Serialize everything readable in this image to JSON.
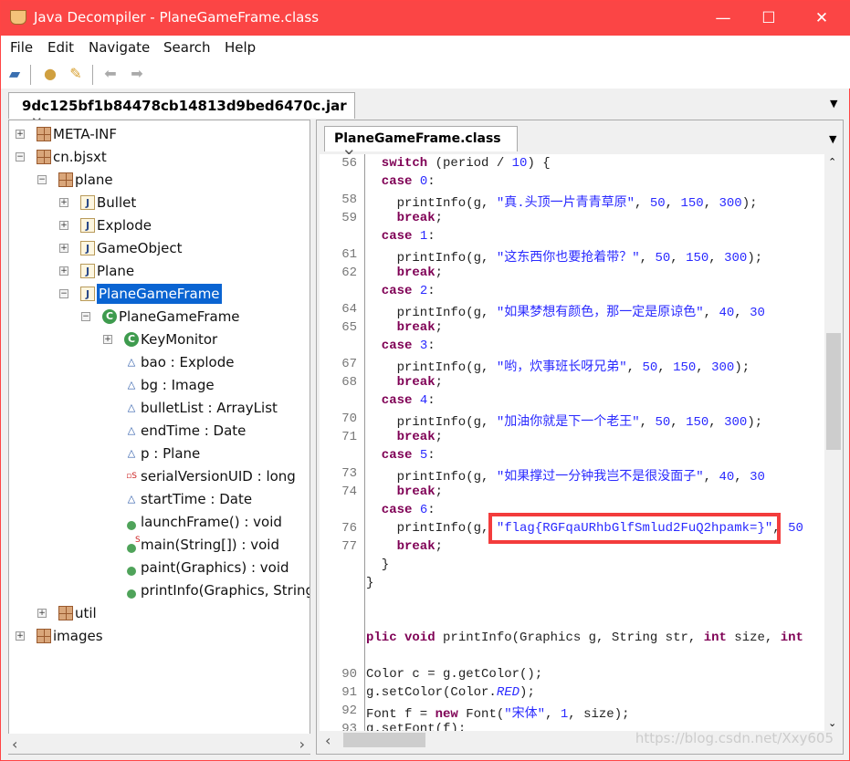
{
  "window": {
    "title": "Java Decompiler - PlaneGameFrame.class",
    "minimize": "—",
    "maximize": "☐",
    "close": "✕"
  },
  "menu": [
    "File",
    "Edit",
    "Navigate",
    "Search",
    "Help"
  ],
  "toolbar": {
    "icons": [
      "open-file-icon",
      "open-type-icon",
      "search-icon",
      "back-icon",
      "forward-icon"
    ],
    "back": "⬅",
    "forward": "➡"
  },
  "outer_tab": {
    "label": "9dc125bf1b84478cb14813d9bed6470c.jar",
    "close": "✕"
  },
  "tree": [
    {
      "depth": 0,
      "exp": "+",
      "icon": "package",
      "label": "META-INF"
    },
    {
      "depth": 0,
      "exp": "−",
      "icon": "package",
      "label": "cn.bjsxt"
    },
    {
      "depth": 1,
      "exp": "−",
      "icon": "package",
      "label": "plane"
    },
    {
      "depth": 2,
      "exp": "+",
      "icon": "java",
      "label": "Bullet"
    },
    {
      "depth": 2,
      "exp": "+",
      "icon": "java",
      "label": "Explode"
    },
    {
      "depth": 2,
      "exp": "+",
      "icon": "java",
      "label": "GameObject"
    },
    {
      "depth": 2,
      "exp": "+",
      "icon": "java",
      "label": "Plane"
    },
    {
      "depth": 2,
      "exp": "−",
      "icon": "java",
      "label": "PlaneGameFrame",
      "selected": true
    },
    {
      "depth": 3,
      "exp": "−",
      "icon": "class",
      "label": "PlaneGameFrame"
    },
    {
      "depth": 4,
      "exp": "+",
      "icon": "class",
      "label": "KeyMonitor"
    },
    {
      "depth": 4,
      "icon": "field",
      "label": "bao : Explode"
    },
    {
      "depth": 4,
      "icon": "field",
      "label": "bg : Image"
    },
    {
      "depth": 4,
      "icon": "field",
      "label": "bulletList : ArrayList"
    },
    {
      "depth": 4,
      "icon": "field",
      "label": "endTime : Date"
    },
    {
      "depth": 4,
      "icon": "field",
      "label": "p : Plane"
    },
    {
      "depth": 4,
      "icon": "static-field",
      "label": "serialVersionUID : long"
    },
    {
      "depth": 4,
      "icon": "field",
      "label": "startTime : Date"
    },
    {
      "depth": 4,
      "icon": "method",
      "label": "launchFrame() : void"
    },
    {
      "depth": 4,
      "icon": "static-method",
      "label": "main(String[]) : void"
    },
    {
      "depth": 4,
      "icon": "method",
      "label": "paint(Graphics) : void"
    },
    {
      "depth": 4,
      "icon": "method",
      "label": "printInfo(Graphics, String"
    },
    {
      "depth": 1,
      "exp": "+",
      "icon": "package",
      "label": "util"
    },
    {
      "depth": 0,
      "exp": "+",
      "icon": "package",
      "label": "images"
    }
  ],
  "code_tab": {
    "label": "PlaneGameFrame.class",
    "close": "✕"
  },
  "code": [
    {
      "n": "56",
      "i": 2,
      "t": [
        [
          "kw",
          "switch"
        ],
        [
          "p",
          " (period / "
        ],
        [
          "num",
          "10"
        ],
        [
          "p",
          ") {"
        ]
      ]
    },
    {
      "n": "",
      "i": 2,
      "t": [
        [
          "kw",
          "case"
        ],
        [
          "p",
          " "
        ],
        [
          "num",
          "0"
        ],
        [
          "p",
          ":"
        ]
      ]
    },
    {
      "n": "58",
      "i": 4,
      "t": [
        [
          "p",
          "printInfo(g, "
        ],
        [
          "str",
          "\"真.头顶一片青青草原\""
        ],
        [
          "p",
          ", "
        ],
        [
          "num",
          "50"
        ],
        [
          "p",
          ", "
        ],
        [
          "num",
          "150"
        ],
        [
          "p",
          ", "
        ],
        [
          "num",
          "300"
        ],
        [
          "p",
          ");"
        ]
      ]
    },
    {
      "n": "59",
      "i": 4,
      "t": [
        [
          "kw",
          "break"
        ],
        [
          "p",
          ";"
        ]
      ]
    },
    {
      "n": "",
      "i": 2,
      "t": [
        [
          "kw",
          "case"
        ],
        [
          "p",
          " "
        ],
        [
          "num",
          "1"
        ],
        [
          "p",
          ":"
        ]
      ]
    },
    {
      "n": "61",
      "i": 4,
      "t": [
        [
          "p",
          "printInfo(g, "
        ],
        [
          "str",
          "\"这东西你也要抢着带？\""
        ],
        [
          "p",
          ", "
        ],
        [
          "num",
          "50"
        ],
        [
          "p",
          ", "
        ],
        [
          "num",
          "150"
        ],
        [
          "p",
          ", "
        ],
        [
          "num",
          "300"
        ],
        [
          "p",
          ");"
        ]
      ]
    },
    {
      "n": "62",
      "i": 4,
      "t": [
        [
          "kw",
          "break"
        ],
        [
          "p",
          ";"
        ]
      ]
    },
    {
      "n": "",
      "i": 2,
      "t": [
        [
          "kw",
          "case"
        ],
        [
          "p",
          " "
        ],
        [
          "num",
          "2"
        ],
        [
          "p",
          ":"
        ]
      ]
    },
    {
      "n": "64",
      "i": 4,
      "t": [
        [
          "p",
          "printInfo(g, "
        ],
        [
          "str",
          "\"如果梦想有颜色，那一定是原谅色\""
        ],
        [
          "p",
          ", "
        ],
        [
          "num",
          "40"
        ],
        [
          "p",
          ", "
        ],
        [
          "num",
          "30"
        ]
      ]
    },
    {
      "n": "65",
      "i": 4,
      "t": [
        [
          "kw",
          "break"
        ],
        [
          "p",
          ";"
        ]
      ]
    },
    {
      "n": "",
      "i": 2,
      "t": [
        [
          "kw",
          "case"
        ],
        [
          "p",
          " "
        ],
        [
          "num",
          "3"
        ],
        [
          "p",
          ":"
        ]
      ]
    },
    {
      "n": "67",
      "i": 4,
      "t": [
        [
          "p",
          "printInfo(g, "
        ],
        [
          "str",
          "\"哟，炊事班长呀兄弟\""
        ],
        [
          "p",
          ", "
        ],
        [
          "num",
          "50"
        ],
        [
          "p",
          ", "
        ],
        [
          "num",
          "150"
        ],
        [
          "p",
          ", "
        ],
        [
          "num",
          "300"
        ],
        [
          "p",
          ");"
        ]
      ]
    },
    {
      "n": "68",
      "i": 4,
      "t": [
        [
          "kw",
          "break"
        ],
        [
          "p",
          ";"
        ]
      ]
    },
    {
      "n": "",
      "i": 2,
      "t": [
        [
          "kw",
          "case"
        ],
        [
          "p",
          " "
        ],
        [
          "num",
          "4"
        ],
        [
          "p",
          ":"
        ]
      ]
    },
    {
      "n": "70",
      "i": 4,
      "t": [
        [
          "p",
          "printInfo(g, "
        ],
        [
          "str",
          "\"加油你就是下一个老王\""
        ],
        [
          "p",
          ", "
        ],
        [
          "num",
          "50"
        ],
        [
          "p",
          ", "
        ],
        [
          "num",
          "150"
        ],
        [
          "p",
          ", "
        ],
        [
          "num",
          "300"
        ],
        [
          "p",
          ");"
        ]
      ]
    },
    {
      "n": "71",
      "i": 4,
      "t": [
        [
          "kw",
          "break"
        ],
        [
          "p",
          ";"
        ]
      ]
    },
    {
      "n": "",
      "i": 2,
      "t": [
        [
          "kw",
          "case"
        ],
        [
          "p",
          " "
        ],
        [
          "num",
          "5"
        ],
        [
          "p",
          ":"
        ]
      ]
    },
    {
      "n": "73",
      "i": 4,
      "t": [
        [
          "p",
          "printInfo(g, "
        ],
        [
          "str",
          "\"如果撑过一分钟我岂不是很没面子\""
        ],
        [
          "p",
          ", "
        ],
        [
          "num",
          "40"
        ],
        [
          "p",
          ", "
        ],
        [
          "num",
          "30"
        ]
      ]
    },
    {
      "n": "74",
      "i": 4,
      "t": [
        [
          "kw",
          "break"
        ],
        [
          "p",
          ";"
        ]
      ]
    },
    {
      "n": "",
      "i": 2,
      "t": [
        [
          "kw",
          "case"
        ],
        [
          "p",
          " "
        ],
        [
          "num",
          "6"
        ],
        [
          "p",
          ":"
        ]
      ]
    },
    {
      "n": "76",
      "i": 4,
      "t": [
        [
          "p",
          "printInfo(g, "
        ],
        [
          "hl",
          "\"flag{RGFqaURhbGlfSmlud2FuQ2hpamk=}\""
        ],
        [
          "p",
          ", "
        ],
        [
          "num",
          "50"
        ]
      ]
    },
    {
      "n": "77",
      "i": 4,
      "t": [
        [
          "kw",
          "break"
        ],
        [
          "p",
          ";"
        ]
      ]
    },
    {
      "n": "",
      "i": 2,
      "t": [
        [
          "p",
          "}"
        ]
      ]
    },
    {
      "n": "",
      "i": 0,
      "t": [
        [
          "p",
          "}"
        ]
      ]
    },
    {
      "n": "",
      "i": 0,
      "t": []
    },
    {
      "n": "",
      "i": 0,
      "t": []
    },
    {
      "n": "",
      "i": 0,
      "t": [
        [
          "kw",
          "plic void"
        ],
        [
          "p",
          " printInfo(Graphics g, String str, "
        ],
        [
          "kw",
          "int"
        ],
        [
          "p",
          " size, "
        ],
        [
          "kw",
          "int"
        ]
      ]
    },
    {
      "n": "",
      "i": 0,
      "t": []
    },
    {
      "n": "90",
      "i": 0,
      "t": [
        [
          "p",
          "Color c = g.getColor();"
        ]
      ]
    },
    {
      "n": "91",
      "i": 0,
      "t": [
        [
          "p",
          "g.setColor(Color."
        ],
        [
          "it",
          "RED"
        ],
        [
          "p",
          ");"
        ]
      ]
    },
    {
      "n": "92",
      "i": 0,
      "t": [
        [
          "p",
          "Font f = "
        ],
        [
          "kw",
          "new"
        ],
        [
          "p",
          " Font("
        ],
        [
          "str",
          "\"宋体\""
        ],
        [
          "p",
          ", "
        ],
        [
          "num",
          "1"
        ],
        [
          "p",
          ", size);"
        ]
      ]
    },
    {
      "n": "93",
      "i": 0,
      "t": [
        [
          "p",
          "g.setFont(f);"
        ]
      ]
    }
  ],
  "watermark": "https://blog.csdn.net/Xxy605",
  "colors": {
    "titlebar": "#fb4545",
    "keyword": "#7f0055",
    "string": "#2a2aff",
    "highlight_box": "#f33c3c",
    "selection": "#0a64d2"
  }
}
